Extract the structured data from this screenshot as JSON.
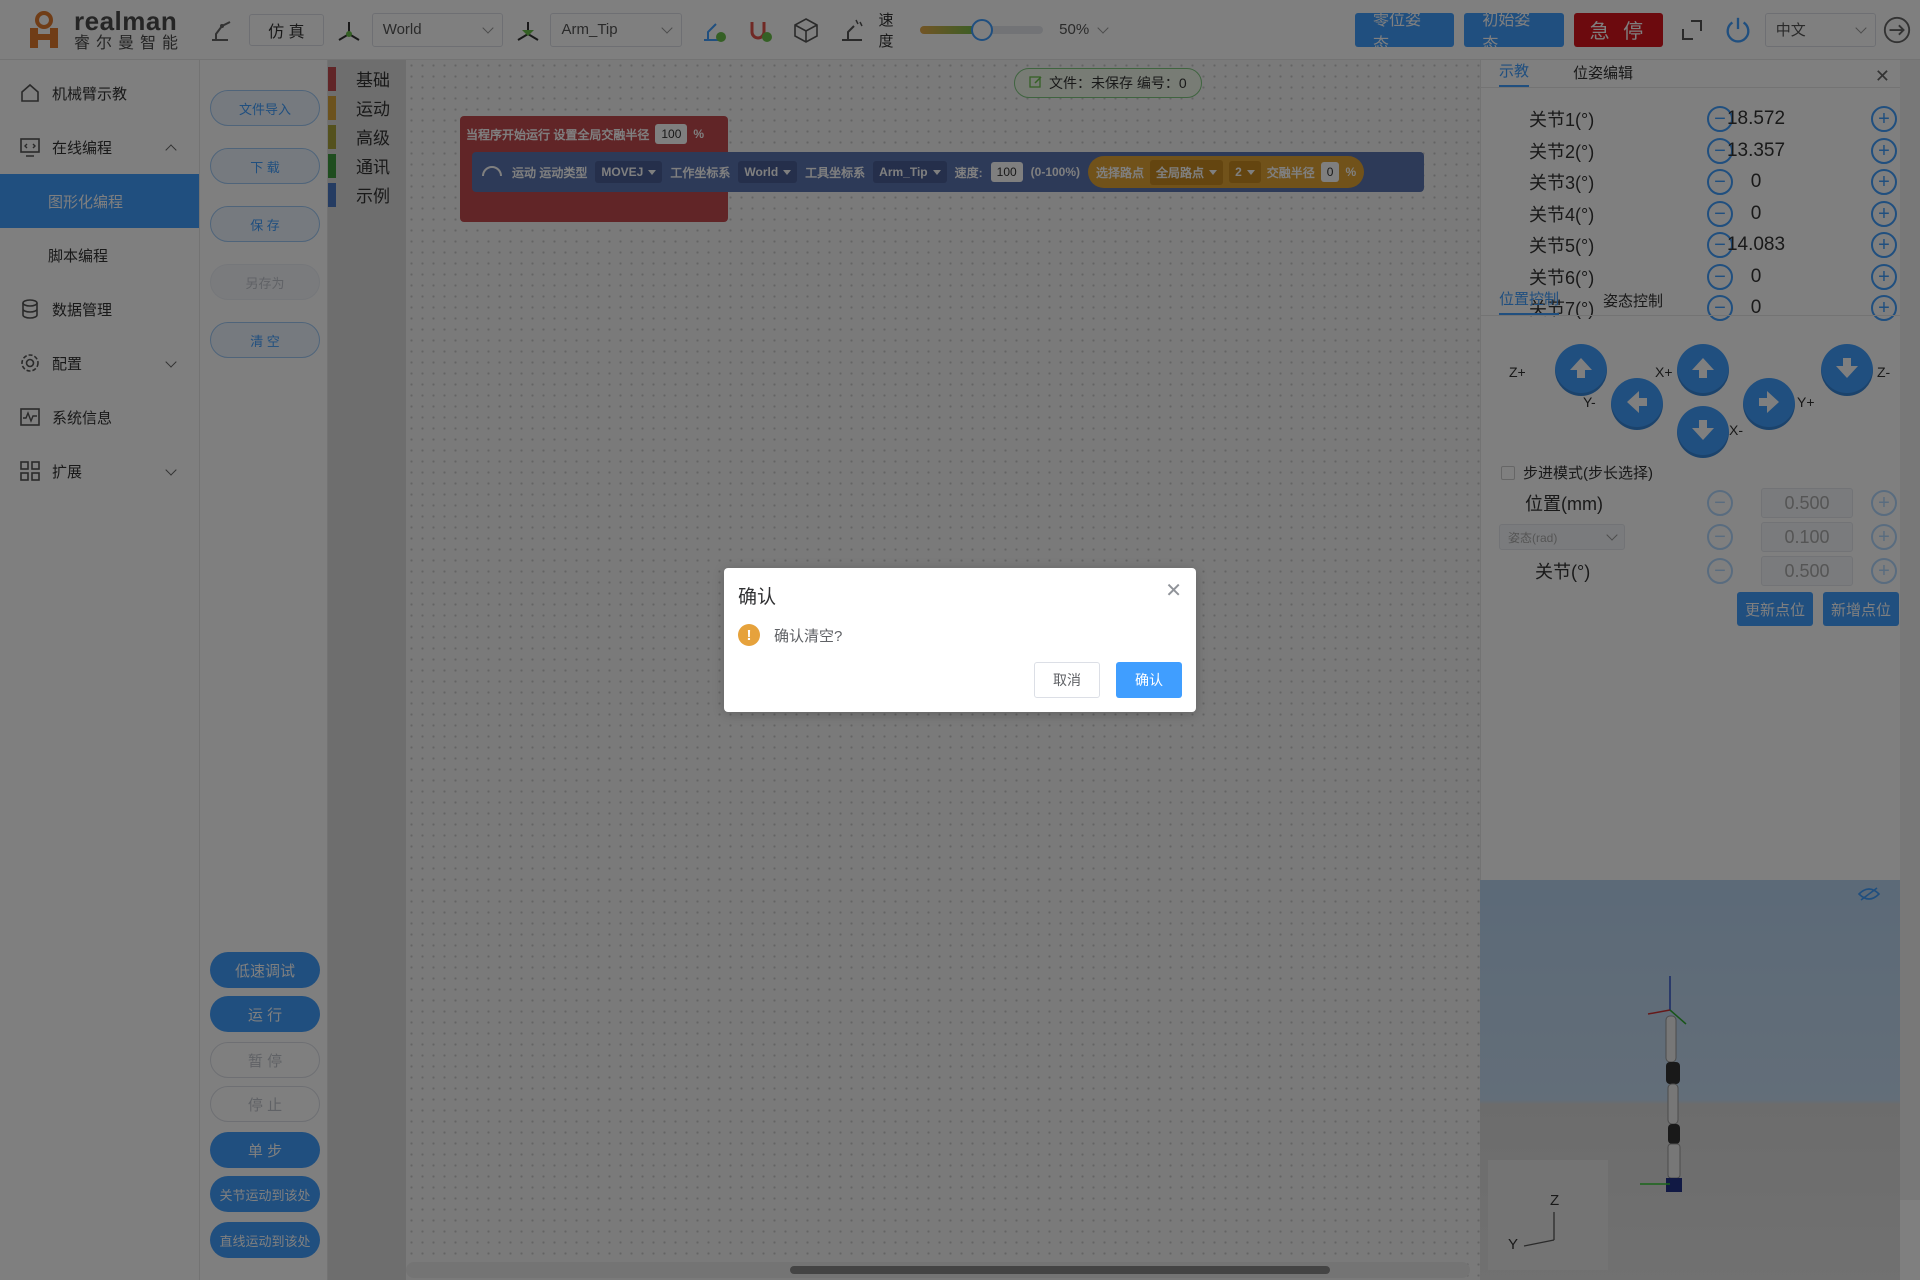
{
  "header": {
    "brand_en": "realman",
    "brand_cn": "睿尔曼智能",
    "sim_label": "仿 真",
    "work_frame": "World",
    "tool_frame": "Arm_Tip",
    "speed_label": "速度",
    "speed_percent": "50%",
    "speed_value": 0.5,
    "btn_zero": "零位姿态",
    "btn_init": "初始姿态",
    "btn_estop": "急 停",
    "language": "中文"
  },
  "sidebar": {
    "items": [
      {
        "label": "机械臂示教",
        "icon": "home-icon"
      },
      {
        "label": "在线编程",
        "icon": "monitor-code-icon"
      },
      {
        "label": "图形化编程"
      },
      {
        "label": "脚本编程"
      },
      {
        "label": "数据管理",
        "icon": "database-icon"
      },
      {
        "label": "配置",
        "icon": "gear-icon"
      },
      {
        "label": "系统信息",
        "icon": "pulse-icon"
      },
      {
        "label": "扩展",
        "icon": "grid-icon"
      }
    ]
  },
  "actions": {
    "import": "文件导入",
    "download": "下 载",
    "save": "保 存",
    "save_as": "另存为",
    "clear": "清 空",
    "low_speed": "低速调试",
    "run": "运 行",
    "pause": "暂 停",
    "stop": "停 止",
    "step": "单 步",
    "joint_move": "关节运动到该处",
    "linear_move": "直线运动到该处"
  },
  "categories": [
    {
      "label": "基础",
      "color": "#c34a4f"
    },
    {
      "label": "运动",
      "color": "#d9a43a"
    },
    {
      "label": "高级",
      "color": "#a9a33a"
    },
    {
      "label": "通讯",
      "color": "#3f9b3f"
    },
    {
      "label": "示例",
      "color": "#4a78c4"
    }
  ],
  "workspace": {
    "file_status": "文件：未保存  编号：0",
    "start_block": {
      "text": "当程序开始运行 设置全局交融半径",
      "value": "100",
      "unit": "%"
    },
    "move_block": {
      "label": "运动 运动类型",
      "move_type": "MOVEJ",
      "work_frame_label": "工作坐标系",
      "work_frame": "World",
      "tool_frame_label": "工具坐标系",
      "tool_frame": "Arm_Tip",
      "speed_label": "速度:",
      "speed_value": "100",
      "speed_range": "(0-100%)",
      "waypoint_label": "选择路点",
      "waypoint_scope": "全局路点",
      "waypoint_index": "2",
      "blend_label": "交融半径",
      "blend_value": "0",
      "blend_unit": "%"
    }
  },
  "right_panel": {
    "tabs": [
      "示教",
      "位姿编辑"
    ],
    "joints": [
      {
        "label": "关节1(°)",
        "value": "18.572"
      },
      {
        "label": "关节2(°)",
        "value": "13.357"
      },
      {
        "label": "关节3(°)",
        "value": "0"
      },
      {
        "label": "关节4(°)",
        "value": "0"
      },
      {
        "label": "关节5(°)",
        "value": "14.083"
      },
      {
        "label": "关节6(°)",
        "value": "0"
      },
      {
        "label": "关节7(°)",
        "value": "0"
      }
    ],
    "control_tabs": [
      "位置控制",
      "姿态控制"
    ],
    "axis_labels": {
      "z_plus": "Z+",
      "z_minus": "Z-",
      "x_plus": "X+",
      "x_minus": "X-",
      "y_plus": "Y+",
      "y_minus": "Y-"
    },
    "step_mode": "步进模式(步长选择)",
    "position_label": "位置(mm)",
    "position_step": "0.500",
    "attitude_select": "姿态(rad)",
    "attitude_step": "0.100",
    "joint_label": "关节(°)",
    "joint_step": "0.500",
    "btn_update": "更新点位",
    "btn_add": "新增点位"
  },
  "view3d": {
    "axis_z": "Z",
    "axis_y": "Y"
  },
  "dialog": {
    "title": "确认",
    "message": "确认清空?",
    "cancel": "取消",
    "confirm": "确认"
  }
}
